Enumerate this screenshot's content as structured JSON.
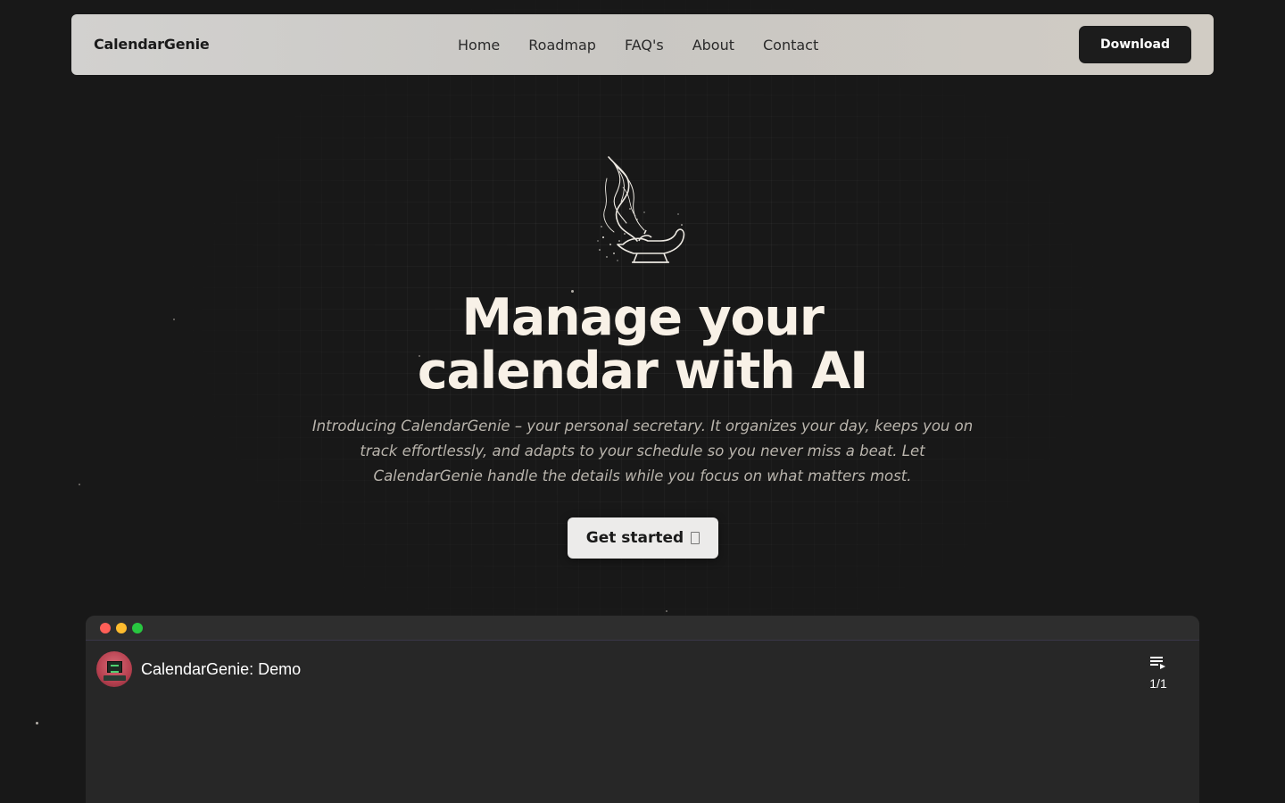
{
  "nav": {
    "brand": "CalendarGenie",
    "links": [
      "Home",
      "Roadmap",
      "FAQ's",
      "About",
      "Contact"
    ],
    "download_label": "Download"
  },
  "hero": {
    "logo_icon": "genie-lamp-icon",
    "headline_line1": "Manage your",
    "headline_line2": "calendar with AI",
    "subtitle": "Introducing CalendarGenie – your personal secretary. It organizes your day, keeps you on track effortlessly, and adapts to your schedule so you never miss a beat. Let CalendarGenie handle the details while you focus on what matters most.",
    "cta_label": "Get started",
    "cta_icon": "arrow-icon"
  },
  "demo": {
    "window_controls": [
      "close",
      "minimize",
      "maximize"
    ],
    "video_title": "CalendarGenie: Demo",
    "playlist_icon": "playlist-icon",
    "playlist_count": "1/1"
  },
  "colors": {
    "background": "#181818",
    "navbar": "#d2d1cf",
    "download_button": "#1c1c1c",
    "headline": "#f8f1e7",
    "cta_button": "#ecebea",
    "demo_window": "#272727"
  }
}
